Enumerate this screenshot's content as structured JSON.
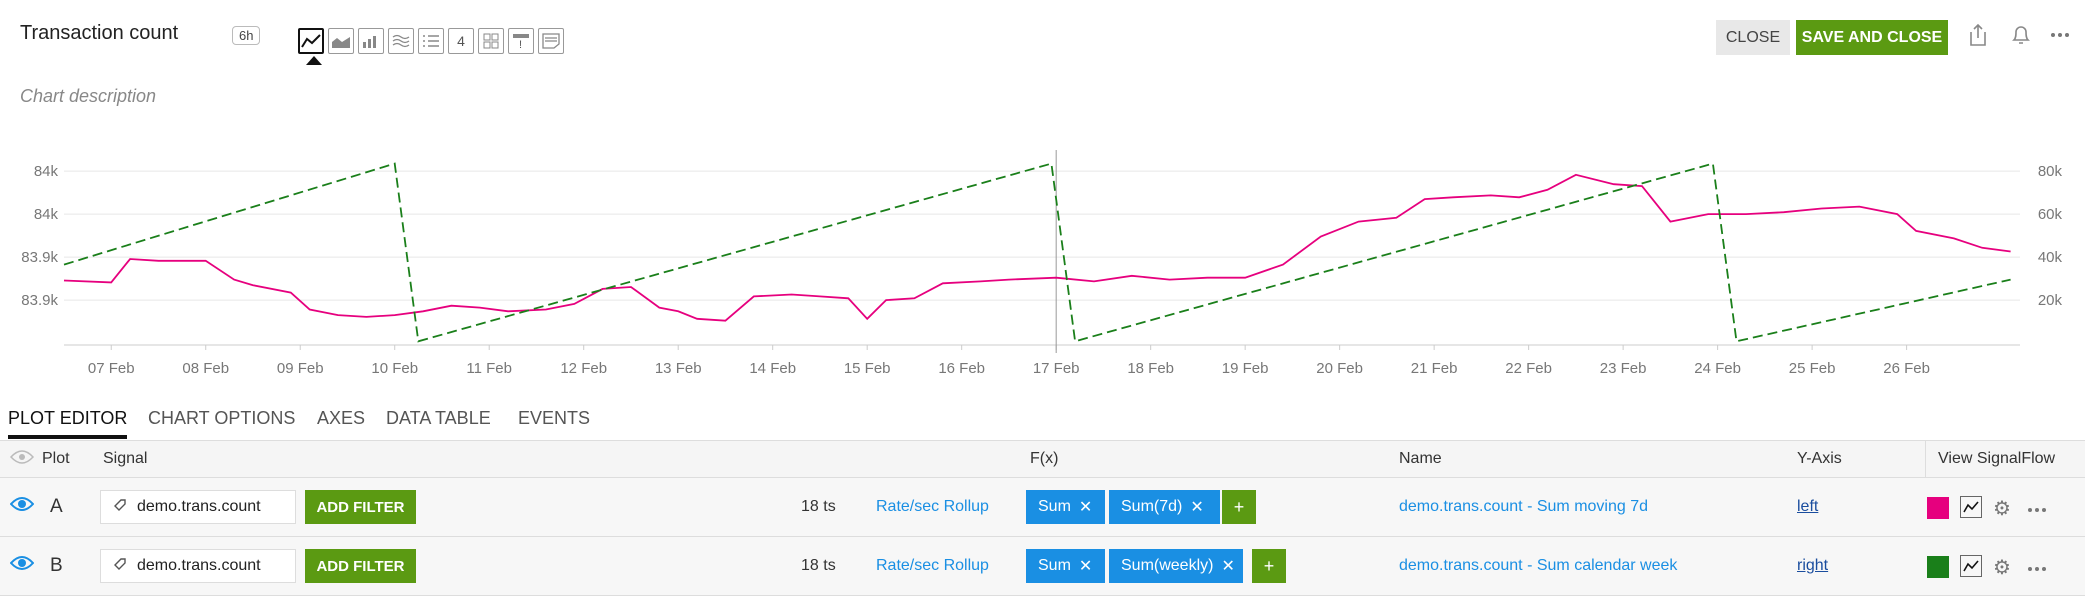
{
  "header": {
    "title": "Transaction count",
    "time_badge": "6h",
    "chart_type_icons": [
      "line-chart-icon",
      "area-chart-icon",
      "column-chart-icon",
      "histogram-icon",
      "list-icon",
      "single-value-icon",
      "heatmap-icon",
      "event-feed-icon",
      "text-note-icon"
    ],
    "single_value_label": "4",
    "close_label": "CLOSE",
    "save_label": "SAVE AND CLOSE",
    "chart_description_placeholder": "Chart description"
  },
  "chart_data": {
    "type": "line",
    "x_labels": [
      "07 Feb",
      "08 Feb",
      "09 Feb",
      "10 Feb",
      "11 Feb",
      "12 Feb",
      "13 Feb",
      "14 Feb",
      "15 Feb",
      "16 Feb",
      "17 Feb",
      "18 Feb",
      "19 Feb",
      "20 Feb",
      "21 Feb",
      "22 Feb",
      "23 Feb",
      "24 Feb",
      "25 Feb",
      "26 Feb"
    ],
    "left_ticks": [
      "84k",
      "84k",
      "83.9k",
      "83.9k"
    ],
    "right_ticks": [
      "80k",
      "60k",
      "40k",
      "20k"
    ],
    "series": [
      {
        "name": "demo.trans.count - Sum moving 7d",
        "color": "#e6007e",
        "axis": "left",
        "points": [
          [
            6.5,
            0.345
          ],
          [
            7.0,
            0.335
          ],
          [
            7.2,
            0.46
          ],
          [
            7.5,
            0.45
          ],
          [
            8.0,
            0.45
          ],
          [
            8.3,
            0.35
          ],
          [
            8.5,
            0.32
          ],
          [
            8.9,
            0.28
          ],
          [
            9.1,
            0.19
          ],
          [
            9.4,
            0.16
          ],
          [
            9.7,
            0.15
          ],
          [
            10.0,
            0.16
          ],
          [
            10.3,
            0.18
          ],
          [
            10.6,
            0.21
          ],
          [
            10.9,
            0.2
          ],
          [
            11.2,
            0.18
          ],
          [
            11.6,
            0.19
          ],
          [
            11.9,
            0.22
          ],
          [
            12.2,
            0.3
          ],
          [
            12.5,
            0.31
          ],
          [
            12.8,
            0.2
          ],
          [
            13.0,
            0.18
          ],
          [
            13.2,
            0.14
          ],
          [
            13.5,
            0.13
          ],
          [
            13.8,
            0.26
          ],
          [
            14.2,
            0.27
          ],
          [
            14.5,
            0.26
          ],
          [
            14.8,
            0.25
          ],
          [
            15.0,
            0.14
          ],
          [
            15.2,
            0.24
          ],
          [
            15.5,
            0.25
          ],
          [
            15.8,
            0.33
          ],
          [
            16.2,
            0.34
          ],
          [
            16.5,
            0.35
          ],
          [
            17.0,
            0.36
          ],
          [
            17.4,
            0.34
          ],
          [
            17.8,
            0.37
          ],
          [
            18.2,
            0.35
          ],
          [
            18.6,
            0.36
          ],
          [
            19.0,
            0.36
          ],
          [
            19.4,
            0.43
          ],
          [
            19.8,
            0.58
          ],
          [
            20.2,
            0.66
          ],
          [
            20.6,
            0.68
          ],
          [
            20.9,
            0.78
          ],
          [
            21.2,
            0.79
          ],
          [
            21.6,
            0.8
          ],
          [
            21.9,
            0.79
          ],
          [
            22.2,
            0.83
          ],
          [
            22.5,
            0.91
          ],
          [
            22.9,
            0.86
          ],
          [
            23.2,
            0.85
          ],
          [
            23.5,
            0.66
          ],
          [
            23.9,
            0.7
          ],
          [
            24.3,
            0.7
          ],
          [
            24.7,
            0.71
          ],
          [
            25.1,
            0.73
          ],
          [
            25.5,
            0.74
          ],
          [
            25.9,
            0.7
          ],
          [
            26.1,
            0.61
          ],
          [
            26.5,
            0.57
          ],
          [
            26.8,
            0.52
          ],
          [
            27.1,
            0.5
          ]
        ]
      },
      {
        "name": "demo.trans.count - Sum calendar week",
        "color": "#1a7f1a",
        "axis": "right",
        "style": "dashed",
        "points": [
          [
            6.5,
            0.43
          ],
          [
            10.0,
            0.97
          ],
          [
            10.25,
            0.02
          ],
          [
            16.95,
            0.97
          ],
          [
            17.2,
            0.02
          ],
          [
            23.95,
            0.97
          ],
          [
            24.2,
            0.02
          ],
          [
            27.1,
            0.35
          ]
        ]
      }
    ],
    "x_range": [
      6.5,
      27.2
    ],
    "cursor_x": 17.0,
    "grid": true
  },
  "tabs": [
    "PLOT EDITOR",
    "CHART OPTIONS",
    "AXES",
    "DATA TABLE",
    "EVENTS"
  ],
  "table": {
    "headers": {
      "plot": "Plot",
      "signal": "Signal",
      "fx": "F(x)",
      "name": "Name",
      "yaxis": "Y-Axis",
      "view_signalflow": "View SignalFlow"
    },
    "rows": [
      {
        "plot": "A",
        "signal": "demo.trans.count",
        "add_filter": "ADD FILTER",
        "ts": "18 ts",
        "rollup": "Rate/sec Rollup",
        "functions": [
          "Sum",
          "Sum(7d)"
        ],
        "plus": "+",
        "name": "demo.trans.count - Sum moving 7d",
        "yaxis": "left",
        "color": "#e6007e"
      },
      {
        "plot": "B",
        "signal": "demo.trans.count",
        "add_filter": "ADD FILTER",
        "ts": "18 ts",
        "rollup": "Rate/sec Rollup",
        "functions": [
          "Sum",
          "Sum(weekly)"
        ],
        "plus": "+",
        "name": "demo.trans.count - Sum calendar week",
        "yaxis": "right",
        "color": "#1a7f1a"
      }
    ]
  }
}
